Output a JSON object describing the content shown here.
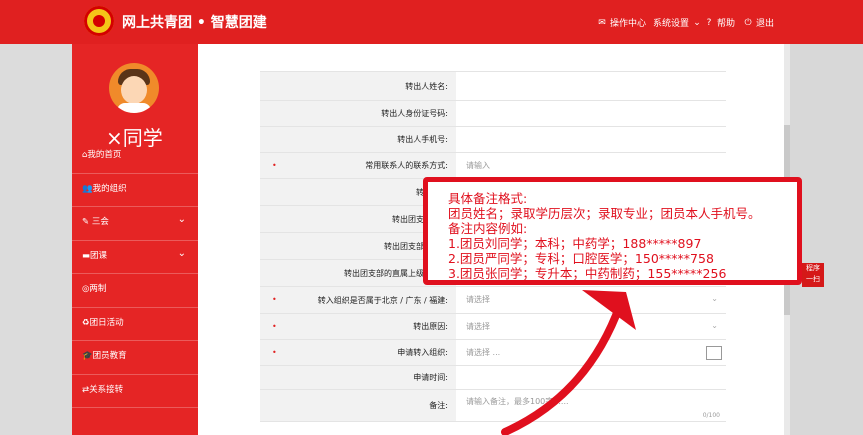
{
  "header": {
    "title": "网上共青团 • 智慧团建",
    "nav": [
      {
        "icon": "mail-icon",
        "label": "操作中心"
      },
      {
        "icon": "",
        "label": "系统设置"
      },
      {
        "icon": "help-icon",
        "label": "帮助"
      },
      {
        "icon": "power-icon",
        "label": "退出"
      }
    ]
  },
  "user": {
    "name": "×同学"
  },
  "sidebar": {
    "items": [
      {
        "icon": "home-icon",
        "label": "我的首页"
      },
      {
        "icon": "group-icon",
        "label": "我的组织"
      },
      {
        "icon": "edit-icon",
        "label": "三会"
      },
      {
        "icon": "folder-icon",
        "label": "团课"
      },
      {
        "icon": "target-icon",
        "label": "两制"
      },
      {
        "icon": "recycle-icon",
        "label": "团日活动"
      },
      {
        "icon": "graduation-cap-icon",
        "label": "团员教育"
      },
      {
        "icon": "transfer-icon",
        "label": "关系接转"
      }
    ]
  },
  "form": {
    "rows": [
      {
        "label": "转出人姓名:",
        "required": false,
        "value": ""
      },
      {
        "label": "转出人身份证号码:",
        "required": false,
        "value": ""
      },
      {
        "label": "转出人手机号:",
        "required": false,
        "value": ""
      },
      {
        "label": "常用联系人的联系方式:",
        "required": true,
        "value": "请输入"
      },
      {
        "label": "转出团支",
        "required": false,
        "value": ""
      },
      {
        "label": "转出团支部管理",
        "required": false,
        "value": ""
      },
      {
        "label": "转出团支部联系方",
        "required": false,
        "value": ""
      },
      {
        "label": "转出团支部的直属上级联系方",
        "required": false,
        "value": ""
      },
      {
        "label": "转入组织是否属于北京 / 广东 / 福建:",
        "required": true,
        "value": "请选择"
      },
      {
        "label": "转出原因:",
        "required": true,
        "value": "请选择"
      },
      {
        "label": "申请转入组织:",
        "required": true,
        "value": "请选择 ..."
      },
      {
        "label": "申请时间:",
        "required": false,
        "value": ""
      },
      {
        "label": "备注:",
        "required": false,
        "value": "请输入备注，最多100字......"
      }
    ],
    "counter": "0/100"
  },
  "note": {
    "lines": [
      "具体备注格式:",
      "团员姓名；录取学历层次；录取专业；团员本人手机号。",
      "备注内容例如:",
      "1.团员刘同学；本科；中药学；188*****897",
      "2.团员严同学；专科；口腔医学；150*****758",
      "3.团员张同学；专升本；中药制药；155*****256"
    ]
  },
  "side_tag": {
    "line1": "程序",
    "line2": "一扫"
  },
  "colors": {
    "primary_red": "#e02020",
    "annotation_red": "#e0101e"
  }
}
